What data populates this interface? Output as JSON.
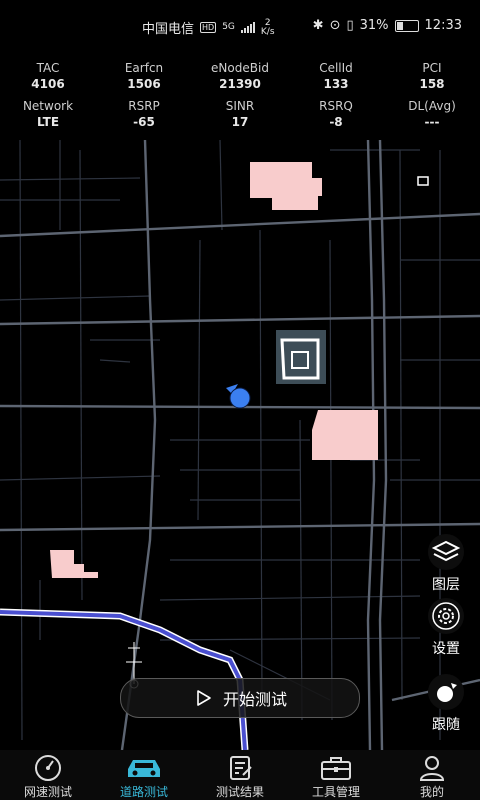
{
  "status_bar": {
    "carrier": "中国电信",
    "hd": "HD",
    "net_type": "5G",
    "speed_num": "2",
    "speed_unit": "K/s",
    "battery": "31%",
    "time": "12:33"
  },
  "cell_info": {
    "row1": [
      {
        "label": "TAC",
        "value": "4106"
      },
      {
        "label": "Earfcn",
        "value": "1506"
      },
      {
        "label": "eNodeBid",
        "value": "21390"
      },
      {
        "label": "CellId",
        "value": "133"
      },
      {
        "label": "PCI",
        "value": "158"
      }
    ],
    "row2": [
      {
        "label": "Network",
        "value": "LTE"
      },
      {
        "label": "RSRP",
        "value": "-65"
      },
      {
        "label": "SINR",
        "value": "17"
      },
      {
        "label": "RSRQ",
        "value": "-8"
      },
      {
        "label": "DL(Avg)",
        "value": "---"
      }
    ]
  },
  "side_controls": {
    "layers": "图层",
    "settings": "设置",
    "follow": "跟随"
  },
  "start_button": "开始测试",
  "tabs": [
    {
      "label": "网速测试",
      "icon": "speedometer-icon",
      "active": false
    },
    {
      "label": "道路测试",
      "icon": "car-icon",
      "active": true
    },
    {
      "label": "测试结果",
      "icon": "clipboard-icon",
      "active": false
    },
    {
      "label": "工具管理",
      "icon": "toolbox-icon",
      "active": false
    },
    {
      "label": "我的",
      "icon": "user-icon",
      "active": false
    }
  ],
  "colors": {
    "accent": "#39b8d8",
    "route": "#4a4fd0",
    "building": "#f8cccc",
    "location": "#3b7ff0"
  }
}
